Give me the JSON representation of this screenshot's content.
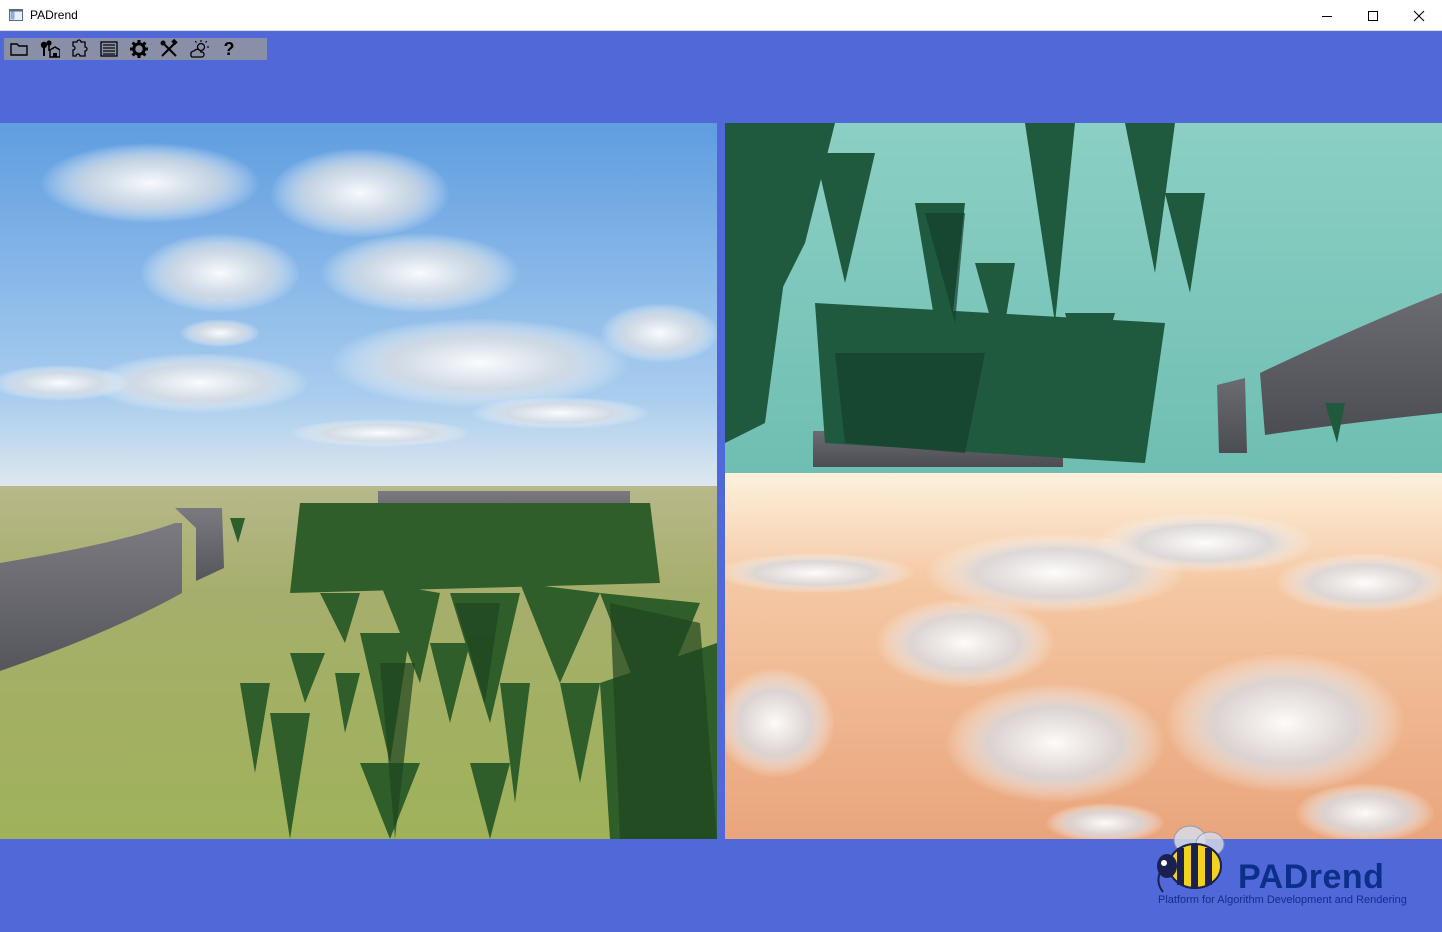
{
  "window": {
    "title": "PADrend"
  },
  "icons": {
    "app": "app-window-icon",
    "minimize": "minimize-icon",
    "maximize": "maximize-icon",
    "close": "close-icon"
  },
  "toolbar": {
    "items": [
      {
        "name": "open-folder-icon"
      },
      {
        "name": "scene-tree-icon"
      },
      {
        "name": "plugins-icon"
      },
      {
        "name": "list-icon"
      },
      {
        "name": "settings-gear-icon"
      },
      {
        "name": "tools-icon"
      },
      {
        "name": "environment-weather-icon"
      },
      {
        "name": "help-question-icon",
        "glyph": "?"
      }
    ]
  },
  "logo": {
    "title": "PADrend",
    "subtitle": "Platform for Algorithm Development and Rendering"
  },
  "colors": {
    "background": "#5068d8",
    "toolbar": "#8a8fa8",
    "logo_text": "#0c2f8a"
  }
}
